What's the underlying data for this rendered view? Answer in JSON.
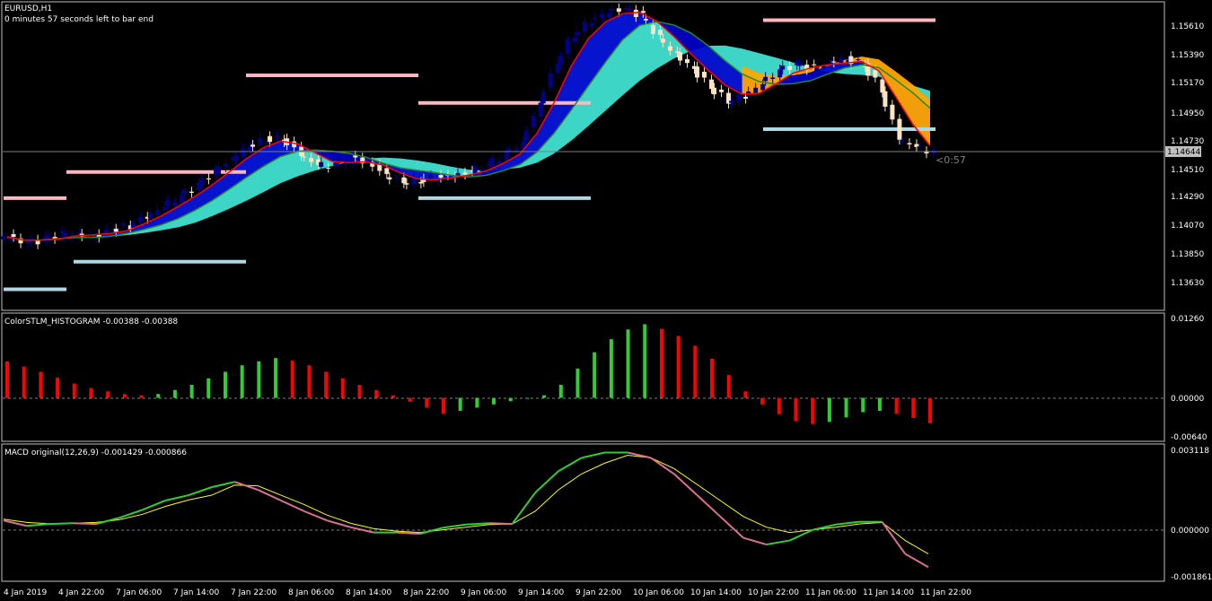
{
  "colors": {
    "background": "#000000",
    "bull_candle": "#00008b",
    "bear_candle": "#ffe4c4",
    "band_fill": "#40e0d0",
    "band_blue": "#0000cd",
    "fast_ma": "#ff0000",
    "slow_ma": "#228b22",
    "orange_band": "#ffa500",
    "resistance": "#ffb6c1",
    "support": "#add8e6",
    "hist_up": "#32cd32",
    "hist_down": "#ff0000",
    "macd_up": "#32cd32",
    "macd_down": "#db7093",
    "signal": "#ffff00",
    "current_price_box": "#c0c0c0",
    "countdown": "#808080"
  },
  "price_panel": {
    "symbol": "EURUSD,H1",
    "timer_text": "0 minutes 57 seconds left to bar end",
    "countdown": "<0:57",
    "current_price": "1.14644",
    "ticks": [
      "1.15610",
      "1.15390",
      "1.15170",
      "1.14950",
      "1.14730",
      "1.14510",
      "1.14290",
      "1.14070",
      "1.13850",
      "1.13630"
    ]
  },
  "histogram_panel": {
    "title": "ColorSTLM_HISTOGRAM -0.00388 -0.00388",
    "ticks": [
      "0.01260",
      "0.00000",
      "-0.00640"
    ]
  },
  "macd_panel": {
    "title": "MACD original(12,26,9) -0.001429 -0.000866",
    "ticks": [
      "0.003118",
      "0.000000",
      "-0.001861"
    ]
  },
  "time_axis": {
    "labels": [
      "4 Jan 2019",
      "4 Jan 22:00",
      "7 Jan 06:00",
      "7 Jan 14:00",
      "7 Jan 22:00",
      "8 Jan 06:00",
      "8 Jan 14:00",
      "8 Jan 22:00",
      "9 Jan 06:00",
      "9 Jan 14:00",
      "9 Jan 22:00",
      "10 Jan 06:00",
      "10 Jan 14:00",
      "10 Jan 22:00",
      "11 Jan 06:00",
      "11 Jan 14:00",
      "11 Jan 22:00"
    ]
  },
  "chart_data": [
    {
      "type": "candlestick",
      "title": "EURUSD,H1",
      "ylim": [
        1.1351,
        1.1572
      ],
      "close_path": [
        1.1403,
        1.1398,
        1.1401,
        1.1405,
        1.1405,
        1.1403,
        1.1408,
        1.1411,
        1.1418,
        1.1425,
        1.1432,
        1.144,
        1.145,
        1.146,
        1.1469,
        1.1474,
        1.1474,
        1.1463,
        1.1455,
        1.1455,
        1.146,
        1.1457,
        1.1448,
        1.1443,
        1.1444,
        1.1446,
        1.1447,
        1.145,
        1.1455,
        1.1463,
        1.1471,
        1.15,
        1.153,
        1.155,
        1.156,
        1.1566,
        1.1568,
        1.1563,
        1.1547,
        1.1535,
        1.1525,
        1.1512,
        1.1502,
        1.1505,
        1.1514,
        1.1523,
        1.1528,
        1.1525,
        1.153,
        1.1532,
        1.1528,
        1.151,
        1.1475,
        1.1468,
        1.1464
      ],
      "levels": [
        {
          "kind": "resistance",
          "y": 1.1431
        },
        {
          "kind": "support",
          "y": 1.1365
        },
        {
          "kind": "resistance",
          "y": 1.145
        },
        {
          "kind": "support",
          "y": 1.1385
        },
        {
          "kind": "resistance",
          "y": 1.152
        },
        {
          "kind": "support",
          "y": 1.1431
        },
        {
          "kind": "resistance",
          "y": 1.15
        },
        {
          "kind": "resistance",
          "y": 1.156
        },
        {
          "kind": "support",
          "y": 1.1481
        }
      ]
    },
    {
      "type": "bar",
      "title": "ColorSTLM_HISTOGRAM -0.00388 -0.00388",
      "ylim": [
        -0.0064,
        0.0126
      ],
      "values": [
        0.0056,
        0.0048,
        0.004,
        0.0031,
        0.0022,
        0.0015,
        0.001,
        0.0006,
        0.0004,
        0.0006,
        0.0012,
        0.002,
        0.003,
        0.004,
        0.005,
        0.0056,
        0.0061,
        0.0057,
        0.005,
        0.004,
        0.003,
        0.002,
        0.0012,
        0.0004,
        -0.0006,
        -0.0015,
        -0.0024,
        -0.002,
        -0.0015,
        -0.001,
        -0.0005,
        0.0,
        0.0004,
        0.002,
        0.0045,
        0.007,
        0.009,
        0.0105,
        0.0113,
        0.0106,
        0.0095,
        0.008,
        0.006,
        0.0035,
        0.001,
        -0.001,
        -0.0025,
        -0.0036,
        -0.004,
        -0.0037,
        -0.003,
        -0.0022,
        -0.002,
        -0.0024,
        -0.0031,
        -0.0039
      ]
    },
    {
      "type": "line",
      "title": "MACD original(12,26,9) -0.001429 -0.000866",
      "ylim": [
        -0.001861,
        0.003118
      ],
      "series": [
        {
          "values": [
            0.00035,
            0.00015,
            0.00022,
            0.00025,
            0.00022,
            0.00045,
            0.00075,
            0.0011,
            0.0013,
            0.0016,
            0.0018,
            0.0015,
            0.0011,
            0.0007,
            0.00035,
            0.0001,
            -0.0001,
            -0.0001,
            -0.00015,
            8e-05,
            0.0002,
            0.00025,
            0.00022,
            0.0014,
            0.0022,
            0.0027,
            0.0029,
            0.0029,
            0.0027,
            0.0021,
            0.0013,
            0.0005,
            -0.0003,
            -0.00055,
            -0.0004,
            0.0,
            0.0002,
            0.0003,
            0.0003,
            -0.0009,
            -0.0014
          ]
        },
        {
          "values": [
            0.0004,
            0.00028,
            0.00023,
            0.00025,
            0.00028,
            0.00038,
            0.00058,
            0.00088,
            0.00112,
            0.0013,
            0.00168,
            0.00165,
            0.0013,
            0.00095,
            0.00055,
            0.00025,
            5e-05,
            -5e-05,
            -0.0001,
            0.0,
            0.0001,
            0.0002,
            0.00022,
            0.0007,
            0.0015,
            0.0021,
            0.0025,
            0.0028,
            0.0027,
            0.0023,
            0.0017,
            0.0011,
            0.0005,
            0.0001,
            -0.0001,
            0.0,
            0.0001,
            0.00022,
            0.00028,
            -0.0004,
            -0.0009
          ]
        }
      ]
    }
  ]
}
